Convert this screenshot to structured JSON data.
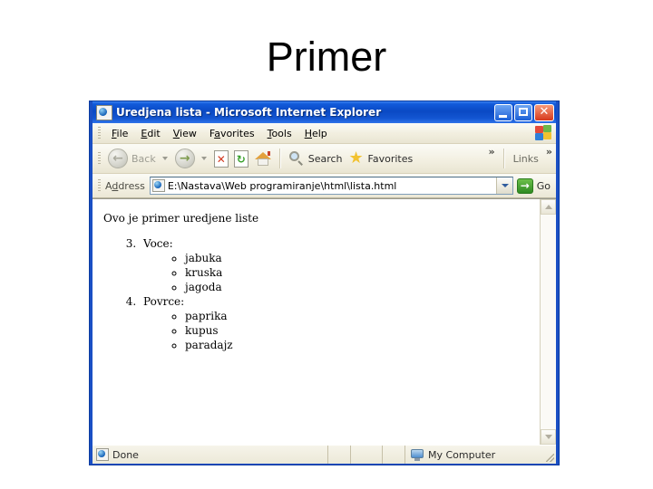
{
  "slide": {
    "title": "Primer"
  },
  "window": {
    "title": "Uredjena lista - Microsoft Internet Explorer",
    "icon": "ie-page-icon",
    "controls": {
      "minimize": "Minimize",
      "maximize": "Maximize",
      "close": "Close"
    }
  },
  "menu": {
    "items": [
      {
        "label": "File",
        "accel": "F",
        "rest": "ile"
      },
      {
        "label": "Edit",
        "accel": "E",
        "rest": "dit"
      },
      {
        "label": "View",
        "accel": "V",
        "rest": "iew"
      },
      {
        "label": "Favorites",
        "accel": "F",
        "rest": "avorites",
        "pre": "F",
        "mid": "a"
      },
      {
        "label": "Tools",
        "accel": "T",
        "rest": "ools"
      },
      {
        "label": "Help",
        "accel": "H",
        "rest": "elp"
      }
    ],
    "brand_icon": "windows-flag-icon"
  },
  "toolbar": {
    "back_label": "Back",
    "forward_label": "",
    "stop_label": "Stop",
    "refresh_label": "Refresh",
    "home_label": "Home",
    "search_label": "Search",
    "favorites_label": "Favorites",
    "overflow_chevron": "»",
    "links_label": "Links",
    "links_chevron": "»"
  },
  "address": {
    "label": "Address",
    "value": "E:\\Nastava\\Web programiranje\\html\\lista.html",
    "placeholder": "",
    "go_label": "Go"
  },
  "page": {
    "intro": "Ovo je primer uredjene liste",
    "list_start": 3,
    "groups": [
      {
        "label": "Voce:",
        "number": "3.",
        "items": [
          "jabuka",
          "kruska",
          "jagoda"
        ]
      },
      {
        "label": "Povrce:",
        "number": "4.",
        "items": [
          "paprika",
          "kupus",
          "paradajz"
        ]
      }
    ]
  },
  "status": {
    "message": "Done",
    "zone": "My Computer",
    "zone_icon": "monitor-icon"
  },
  "colors": {
    "title_bar_blue": "#0a49c4",
    "window_frame": "#1a4fc4",
    "chrome_beige": "#ece9d8",
    "close_red": "#d6381c",
    "go_green": "#2f8a22",
    "star_yellow": "#f2c230"
  }
}
